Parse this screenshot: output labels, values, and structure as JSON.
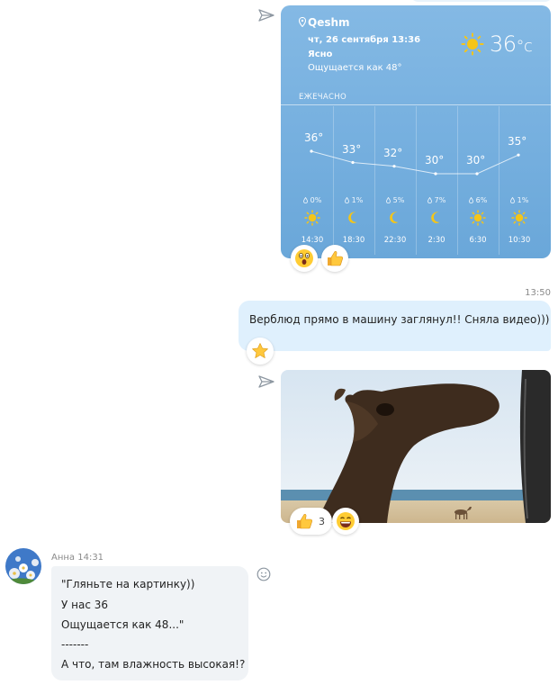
{
  "weather": {
    "location": "Qeshm",
    "date": "чт, 26 сентября 13:36",
    "condition": "Ясно",
    "feels": "Ощущается как 48°",
    "temp": "36",
    "unit": "°c",
    "hourly_label": "ЕЖЕЧАСНО",
    "hours": [
      {
        "temp": "36°",
        "precip": "0%",
        "icon": "sun-icon",
        "time": "14:30"
      },
      {
        "temp": "33°",
        "precip": "1%",
        "icon": "moon-icon",
        "time": "18:30"
      },
      {
        "temp": "32°",
        "precip": "5%",
        "icon": "moon-icon",
        "time": "22:30"
      },
      {
        "temp": "30°",
        "precip": "7%",
        "icon": "moon-icon",
        "time": "2:30"
      },
      {
        "temp": "30°",
        "precip": "6%",
        "icon": "sun-icon",
        "time": "6:30"
      },
      {
        "temp": "35°",
        "precip": "1%",
        "icon": "sun-icon",
        "time": "10:30"
      }
    ],
    "reactions": [
      "surprised-emoji-icon",
      "thumbs-up-emoji-icon"
    ]
  },
  "message_out": {
    "time": "13:50",
    "text": "Верблюд прямо в машину заглянул!! Сняла видео)))",
    "reaction": "star-emoji-icon"
  },
  "camel_post": {
    "reactions": [
      {
        "icon": "thumbs-up-emoji-icon",
        "count": "3"
      },
      {
        "icon": "laughing-emoji-icon",
        "count": ""
      }
    ]
  },
  "message_in": {
    "sender": "Анна 14:31",
    "lines": [
      "\"Гляньте на картинку))",
      "У нас 36",
      "Ощущается как 48...\"",
      "-------",
      "А что, там влажность высокая!?"
    ]
  },
  "colors": {
    "weather_bg": "#78b1e0",
    "out_bubble": "#dff0fd",
    "in_bubble": "#f0f3f6",
    "sun": "#f5c518"
  }
}
